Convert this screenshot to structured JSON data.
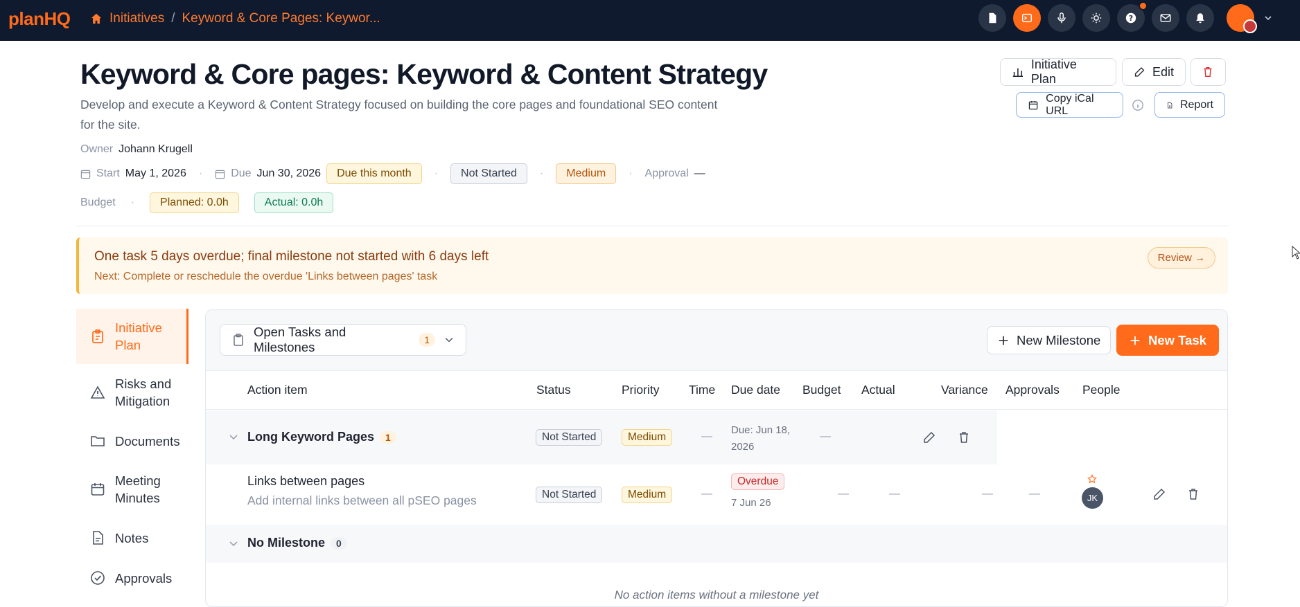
{
  "app": {
    "logo": "planHQ"
  },
  "breadcrumb": {
    "home": "Initiatives",
    "sep": "/",
    "current": "Keyword & Core Pages: Keywor..."
  },
  "page": {
    "title": "Keyword & Core pages: Keyword & Content Strategy",
    "description": "Develop and execute a Keyword & Content Strategy focused on building the core pages and foundational SEO content for the site."
  },
  "actions": {
    "initiative_plan": "Initiative Plan",
    "edit": "Edit",
    "copy_ical": "Copy iCal URL",
    "report": "Report"
  },
  "meta": {
    "owner_label": "Owner",
    "owner": "Johann Krugell",
    "start_label": "Start",
    "start": "May 1, 2026",
    "due_label": "Due",
    "due": "Jun 30, 2026",
    "due_badge": "Due this month",
    "status": "Not Started",
    "priority": "Medium",
    "approval_label": "Approval",
    "approval": "—",
    "budget_label": "Budget",
    "planned": "Planned: 0.0h",
    "actual": "Actual: 0.0h",
    "sep": "·"
  },
  "alert": {
    "headline": "One task 5 days overdue; final milestone not started with 6 days left",
    "next": "Next: Complete or reschedule the overdue 'Links between pages' task",
    "review": "Review →"
  },
  "sidenav": [
    {
      "label": "Initiative Plan",
      "icon": "clipboard-icon"
    },
    {
      "label": "Risks and Mitigation",
      "icon": "warning-icon"
    },
    {
      "label": "Documents",
      "icon": "folder-icon"
    },
    {
      "label": "Meeting Minutes",
      "icon": "calendar-icon"
    },
    {
      "label": "Notes",
      "icon": "note-icon"
    },
    {
      "label": "Approvals",
      "icon": "check-circle-icon"
    }
  ],
  "toolbar": {
    "filter": "Open Tasks and Milestones",
    "filter_count": "1",
    "new_milestone": "New Milestone",
    "new_task": "New Task"
  },
  "table": {
    "headers": [
      "Action item",
      "Status",
      "Priority",
      "Time",
      "Due date",
      "Budget",
      "Actual",
      "Variance",
      "Approvals",
      "People"
    ],
    "milestone": {
      "name": "Long Keyword Pages",
      "count": "1",
      "status": "Not Started",
      "priority": "Medium",
      "time": "—",
      "due_line1": "Due: Jun 18,",
      "due_line2": "2026",
      "budget": "—"
    },
    "task": {
      "name": "Links between pages",
      "desc": "Add internal links between all pSEO pages",
      "status": "Not Started",
      "priority": "Medium",
      "time": "—",
      "due_badge": "Overdue",
      "due_date": "7 Jun 26",
      "budget": "—",
      "actual": "—",
      "variance": "—",
      "approvals": "—",
      "person": "JK"
    },
    "no_milestone": {
      "name": "No Milestone",
      "count": "0"
    },
    "empty": "No action items without a milestone yet"
  },
  "colors": {
    "brand": "#ff6b1a",
    "topbar": "#0f1a2e"
  }
}
